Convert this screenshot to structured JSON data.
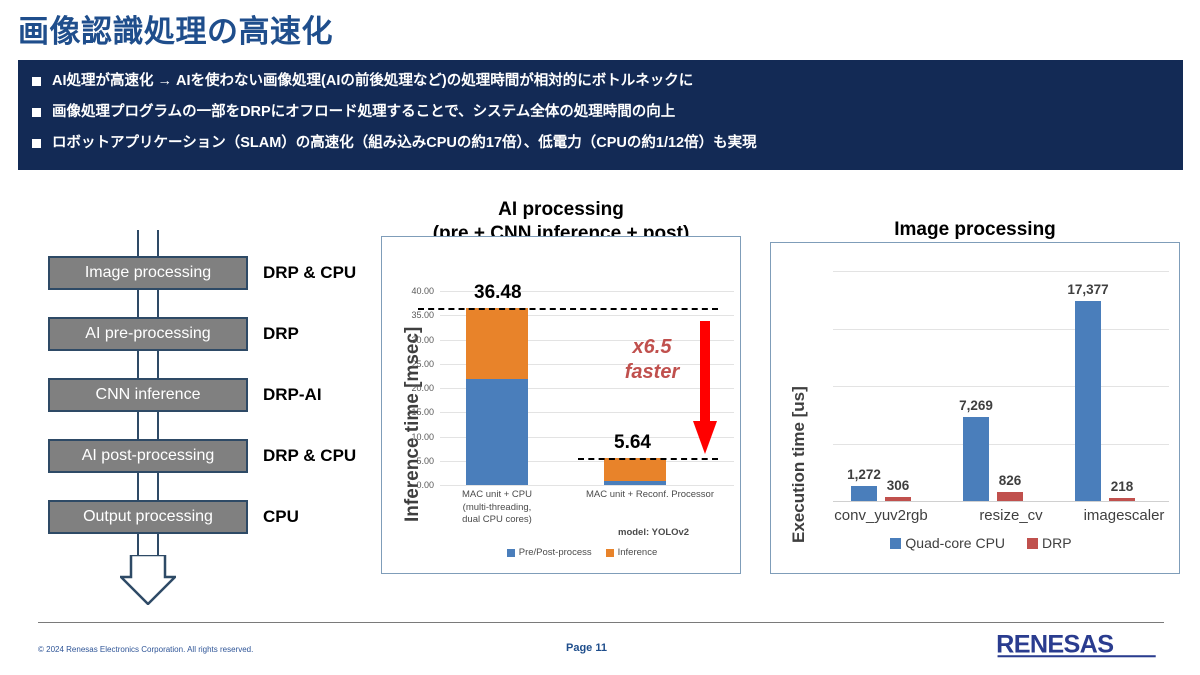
{
  "slide": {
    "title": "画像認識処理の高速化",
    "page_label": "Page 11",
    "copyright": "© 2024 Renesas Electronics Corporation. All rights reserved.",
    "brand": "RENESAS",
    "colors": {
      "title_blue": "#1F4E8C",
      "navy_bar": "#132A55",
      "box_gray": "#808080",
      "box_border": "#2E4A66",
      "series_blue": "#4A7EBB",
      "series_orange": "#E8832A",
      "series_red": "#C0504D",
      "accent_red_arrow": "#FF0000"
    }
  },
  "bullets": [
    "AI処理が高速化 → AIを使わない画像処理(AIの前後処理など)の処理時間が相対的にボトルネックに",
    "画像処理プログラムの一部をDRPにオフロード処理することで、システム全体の処理時間の向上",
    "ロボットアプリケーション（SLAM）の高速化（組み込みCPUの約17倍）、低電力（CPUの約1/12倍）も実現"
  ],
  "flow": {
    "steps": [
      {
        "name": "Image processing",
        "engine": "DRP & CPU"
      },
      {
        "name": "AI pre-processing",
        "engine": "DRP"
      },
      {
        "name": "CNN inference",
        "engine": "DRP-AI"
      },
      {
        "name": "AI post-processing",
        "engine": "DRP & CPU"
      },
      {
        "name": "Output processing",
        "engine": "CPU"
      }
    ]
  },
  "chart_data": [
    {
      "id": "ai_processing",
      "type": "bar",
      "stacked": true,
      "title": "AI processing\n(pre + CNN inference + post)",
      "title_line1": "AI processing",
      "title_line2": "(pre + CNN inference + post)",
      "xlabel": "",
      "ylabel": "Inference time [msec]",
      "ylim": [
        0,
        40
      ],
      "ytick_labels": [
        "40.00",
        "35.00",
        "30.00",
        "25.00",
        "20.00",
        "15.00",
        "10.00",
        "5.00",
        "0.00"
      ],
      "ytick_values": [
        40,
        35,
        30,
        25,
        20,
        15,
        10,
        5,
        0
      ],
      "grid": true,
      "legend_position": "bottom",
      "categories": [
        "MAC unit + CPU\n(multi-threading,\ndual CPU cores)",
        "MAC unit + Reconf. Processor"
      ],
      "category_lines": [
        [
          "MAC unit + CPU",
          "(multi-threading,",
          "dual CPU cores)"
        ],
        [
          "MAC unit + Reconf. Processor"
        ]
      ],
      "series": [
        {
          "name": "Pre/Post-process",
          "color": "#4A7EBB",
          "values": [
            21.9,
            0.9
          ]
        },
        {
          "name": "Inference",
          "color": "#E8832A",
          "values": [
            14.58,
            4.74
          ]
        }
      ],
      "totals": [
        36.48,
        5.64
      ],
      "total_labels": [
        "36.48",
        "5.64"
      ],
      "annotations": {
        "speedup_line1": "x6.5",
        "speedup_line2": "faster",
        "model_note": "model: YOLOv2",
        "dashed_levels": [
          36.48,
          5.64
        ]
      }
    },
    {
      "id": "image_processing",
      "type": "bar",
      "stacked": false,
      "title": "Image processing",
      "xlabel": "",
      "ylabel": "Execution time [us]",
      "ylim": [
        0,
        20000
      ],
      "gridline_values": [
        20000,
        15000,
        10000,
        5000
      ],
      "grid": true,
      "legend_position": "bottom",
      "categories": [
        "conv_yuv2rgb",
        "resize_cv",
        "imagescaler"
      ],
      "series": [
        {
          "name": "Quad-core CPU",
          "color": "#4A7EBB",
          "values": [
            1272,
            7269,
            17377
          ],
          "labels": [
            "1,272",
            "7,269",
            "17,377"
          ]
        },
        {
          "name": "DRP",
          "color": "#C0504D",
          "values": [
            306,
            826,
            218
          ],
          "labels": [
            "306",
            "826",
            "218"
          ]
        }
      ]
    }
  ]
}
